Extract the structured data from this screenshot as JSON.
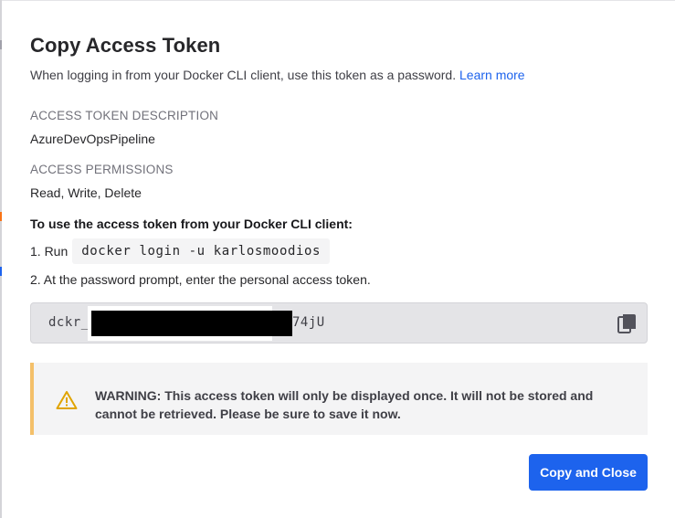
{
  "dialog": {
    "title": "Copy Access Token",
    "subtitle": "When logging in from your Docker CLI client, use this token as a password.",
    "learn_more": "Learn more"
  },
  "description": {
    "label": "ACCESS TOKEN DESCRIPTION",
    "value": "AzureDevOpsPipeline"
  },
  "permissions": {
    "label": "ACCESS PERMISSIONS",
    "value": "Read, Write, Delete"
  },
  "instructions": {
    "title": "To use the access token from your Docker CLI client:",
    "step1_prefix": "1. Run",
    "step1_command": "docker login -u karlosmoodios",
    "step2": "2. At the password prompt, enter the personal access token."
  },
  "token": {
    "prefix": "dckr_",
    "suffix": "74jU",
    "copy_icon": "copy-icon"
  },
  "warning": {
    "icon": "warning-triangle-icon",
    "text": "WARNING: This access token will only be displayed once. It will not be stored and cannot be retrieved. Please be sure to save it now."
  },
  "actions": {
    "copy_and_close": "Copy and Close"
  },
  "colors": {
    "accent": "#1d63ed",
    "warning_border": "#f4c06a",
    "warning_icon": "#e0a400",
    "token_bg": "#e4e4e7"
  }
}
